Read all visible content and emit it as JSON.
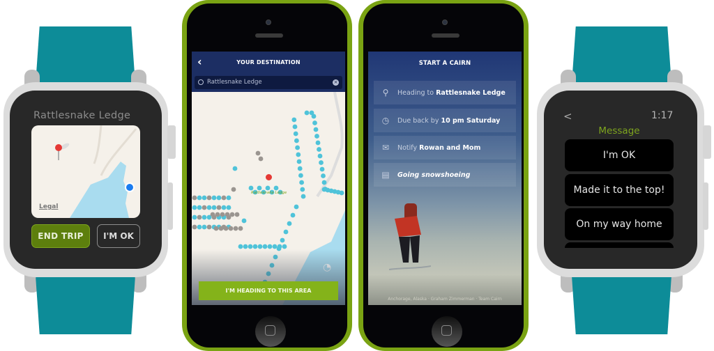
{
  "left_watch": {
    "title": "Rattlesnake Ledge",
    "map_legal": "Legal",
    "end_trip_button": "END TRIP",
    "im_ok_button": "I'M OK"
  },
  "phone_destination": {
    "header_title": "YOUR DESTINATION",
    "back_icon": "chevron-left-icon",
    "search_value": "Rattlesnake Ledge",
    "map_label": "Rattlesnake Ledge",
    "cta_button": "I'M HEADING TO THIS AREA"
  },
  "phone_cairn": {
    "header_title": "START A CAIRN",
    "rows": [
      {
        "icon": "location-pin-icon",
        "prefix": "Heading to",
        "value": "Rattlesnake Ledge"
      },
      {
        "icon": "alarm-clock-icon",
        "prefix": "Due back by",
        "value": "10 pm Saturday"
      },
      {
        "icon": "envelope-icon",
        "prefix": "Notify",
        "value": "Rowan and Mom"
      },
      {
        "icon": "note-icon",
        "prefix": "",
        "value": "Going snowshoeing"
      }
    ],
    "photo_credit": "Anchorage, Alaska  ·  Graham Zimmerman  ·  Team Cairn"
  },
  "right_watch": {
    "back_label": "<",
    "time": "1:17",
    "heading": "Message",
    "messages": [
      "I'm OK",
      "Made it to the top!",
      "On my way home"
    ]
  },
  "colors": {
    "strap": "#0d8c98",
    "phone_frame": "#7aa313",
    "accent_green": "#84b31a",
    "header_navy": "#1c2e63",
    "trail_dots": "#4fc3d9"
  }
}
